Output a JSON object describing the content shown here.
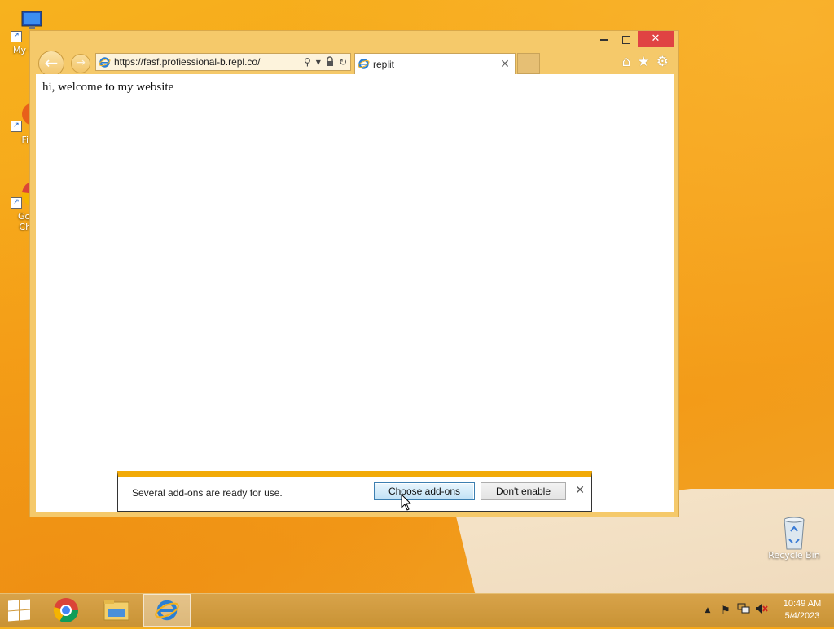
{
  "desktop": {
    "icons": [
      {
        "label": "My Co",
        "icon": "computer-icon"
      },
      {
        "label": "Fir",
        "icon": "firefox-icon"
      },
      {
        "label": "Goo\nChr",
        "icon": "chrome-icon"
      },
      {
        "label": "Recycle Bin",
        "icon": "recycle-bin-icon"
      }
    ]
  },
  "browser": {
    "window_controls": {
      "minimize": "minimize",
      "maximize": "maximize",
      "close": "✕"
    },
    "address": "https://fasf.profiessional-b.repl.co/",
    "tab": {
      "title": "replit",
      "close": "✕"
    },
    "toolbar_icons": [
      "home-icon",
      "favorites-icon",
      "settings-icon"
    ],
    "page": {
      "text": "hi, welcome to my website"
    }
  },
  "notification": {
    "message": "Several add-ons are ready for use.",
    "primary_button": "Choose add-ons",
    "secondary_button": "Don't enable",
    "close": "✕"
  },
  "taskbar": {
    "apps": [
      "chrome-icon",
      "file-explorer-icon",
      "internet-explorer-icon"
    ],
    "active_app": "internet-explorer-icon",
    "clock": {
      "time": "10:49 AM",
      "date": "5/4/2023"
    }
  },
  "colors": {
    "accent": "#f2aa07",
    "desktop": "#f6a319",
    "window_frame": "#f5c96a"
  }
}
